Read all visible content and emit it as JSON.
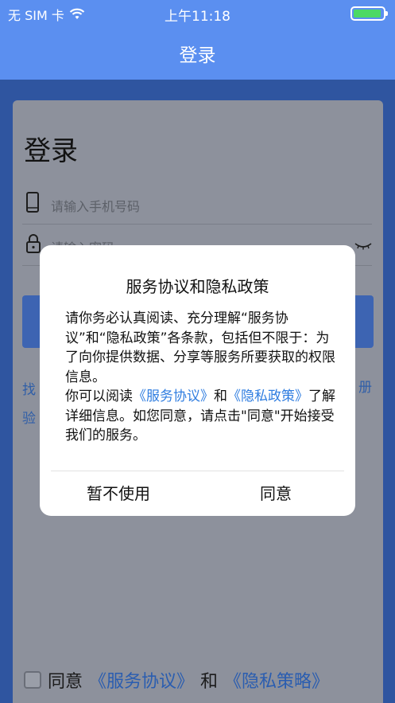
{
  "status_bar": {
    "carrier": "无 SIM 卡",
    "time": "上午11:18",
    "icons": {
      "wifi": "wifi-icon",
      "battery": "battery-icon"
    },
    "battery_level": 0.9
  },
  "nav": {
    "title": "登录"
  },
  "login": {
    "heading": "登录",
    "phone_placeholder": "请输入手机号码",
    "password_placeholder": "请输入密码",
    "left_link_1": "找",
    "left_link_2": "验",
    "right_link": "册"
  },
  "agreement_row": {
    "prefix": "同意",
    "link1": "《服务协议》",
    "and": "和",
    "link2": "《隐私策略》"
  },
  "dialog": {
    "title": "服务协议和隐私政策",
    "paragraph1": "请你务必认真阅读、充分理解“服务协议”和“隐私政策”各条款，包括但不限于：为了向你提供数据、分享等服务所要获取的权限信息。",
    "p2_prefix": "你可以阅读",
    "p2_link1": "《服务协议》",
    "p2_and": "和",
    "p2_link2": "《隐私政策》",
    "p2_suffix": "了解详细信息。如您同意，请点击\"同意\"开始接受我们的服务。",
    "cancel_label": "暂不使用",
    "confirm_label": "同意"
  },
  "colors": {
    "nav_blue": "#5b8ff0",
    "link_blue": "#2f7de0",
    "battery_green": "#4cd964"
  }
}
